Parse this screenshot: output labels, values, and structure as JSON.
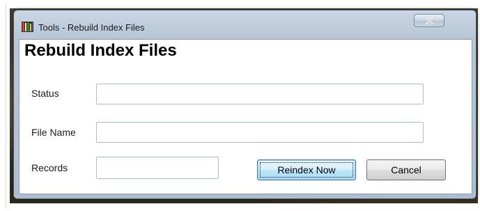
{
  "window": {
    "title": "Tools - Rebuild Index Files",
    "icon": "tools-app-icon",
    "close_icon": "close-x-icon"
  },
  "dialog": {
    "heading": "Rebuild Index Files",
    "fields": {
      "status": {
        "label": "Status",
        "value": ""
      },
      "file_name": {
        "label": "File Name",
        "value": ""
      },
      "records": {
        "label": "Records",
        "value": ""
      }
    },
    "buttons": {
      "reindex": "Reindex Now",
      "cancel": "Cancel"
    }
  },
  "colors": {
    "frame": "#b8c7d8",
    "default_button": "#bee6fd",
    "input_border": "#a9bdd3"
  }
}
